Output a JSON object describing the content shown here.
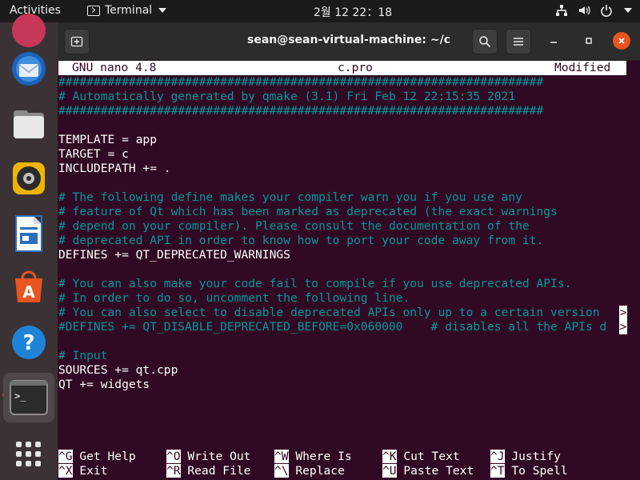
{
  "topbar": {
    "activities": "Activities",
    "app_name": "Terminal",
    "clock": "2월 12  22：18"
  },
  "dock": {
    "items": [
      "firefox-icon",
      "thunderbird-icon",
      "files-icon",
      "rhythmbox-icon",
      "libreoffice-writer-icon",
      "ubuntu-software-icon",
      "help-icon",
      "terminal-icon",
      "show-applications-icon"
    ]
  },
  "window": {
    "title": "sean@sean-virtual-machine: ~/c"
  },
  "nano": {
    "version": "GNU nano 4.8",
    "filename": "c.pro",
    "status": "Modified",
    "lines": [
      {
        "text": "#####################################################################",
        "type": "comment"
      },
      {
        "text": "# Automatically generated by qmake (3.1) Fri Feb 12 22:15:35 2021",
        "type": "comment"
      },
      {
        "text": "#####################################################################",
        "type": "comment"
      },
      {
        "text": "",
        "type": "plain"
      },
      {
        "text": "TEMPLATE = app",
        "type": "plain"
      },
      {
        "text": "TARGET = c",
        "type": "plain"
      },
      {
        "text": "INCLUDEPATH += .",
        "type": "plain"
      },
      {
        "text": "",
        "type": "plain"
      },
      {
        "text": "# The following define makes your compiler warn you if you use any",
        "type": "comment"
      },
      {
        "text": "# feature of Qt which has been marked as deprecated (the exact warnings",
        "type": "comment"
      },
      {
        "text": "# depend on your compiler). Please consult the documentation of the",
        "type": "comment"
      },
      {
        "text": "# deprecated API in order to know how to port your code away from it.",
        "type": "comment"
      },
      {
        "text": "DEFINES += QT_DEPRECATED_WARNINGS",
        "type": "plain"
      },
      {
        "text": "",
        "type": "plain"
      },
      {
        "text": "# You can also make your code fail to compile if you use deprecated APIs.",
        "type": "comment"
      },
      {
        "text": "# In order to do so, uncomment the following line.",
        "type": "comment"
      },
      {
        "text": "# You can also select to disable deprecated APIs only up to a certain version ",
        "type": "comment",
        "overflow": true
      },
      {
        "text": "#DEFINES += QT_DISABLE_DEPRECATED_BEFORE=0x060000    # disables all the APIs d",
        "type": "comment",
        "overflow": true
      },
      {
        "text": "",
        "type": "plain"
      },
      {
        "text": "# Input",
        "type": "comment"
      },
      {
        "text": "SOURCES += qt.cpp",
        "type": "plain"
      },
      {
        "text": "QT += widgets",
        "type": "plain"
      }
    ],
    "overflow_mark": ">",
    "shortcuts": [
      {
        "key": "^G",
        "label": "Get Help"
      },
      {
        "key": "^O",
        "label": "Write Out"
      },
      {
        "key": "^W",
        "label": "Where Is"
      },
      {
        "key": "^K",
        "label": "Cut Text"
      },
      {
        "key": "^J",
        "label": "Justify"
      },
      {
        "key": "^X",
        "label": "Exit"
      },
      {
        "key": "^R",
        "label": "Read File"
      },
      {
        "key": "^\\",
        "label": "Replace"
      },
      {
        "key": "^U",
        "label": "Paste Text"
      },
      {
        "key": "^T",
        "label": "To Spell"
      }
    ]
  },
  "colors": {
    "terminal_bg": "#300a24",
    "comment": "#06989a",
    "accent": "#e95420"
  }
}
